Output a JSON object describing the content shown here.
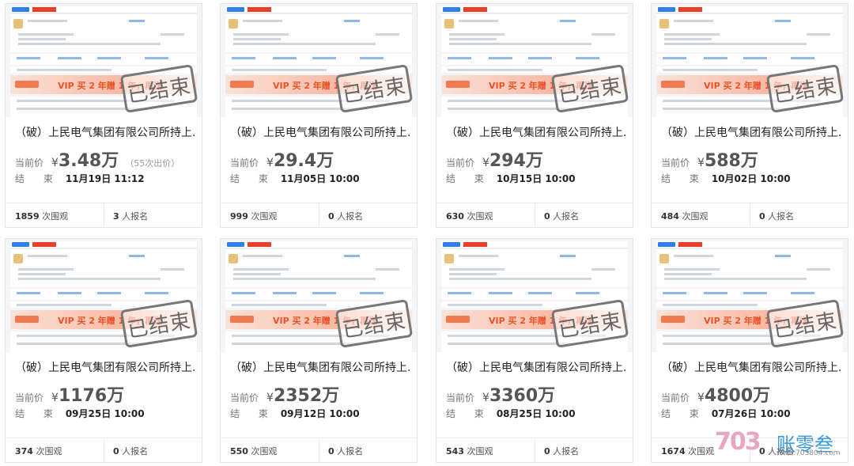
{
  "promo_text": "VIP 买 2 年赠 1 年，再送",
  "stamp_text": "已结束",
  "labels": {
    "current_price": "当前价",
    "end": "结  束",
    "currency": "¥"
  },
  "cards": [
    {
      "title": "（破）上民电气集团有限公司所持上...",
      "price": "3.48万",
      "bids": "（55次出价）",
      "end_time": "11月19日 11:12",
      "views": "1859",
      "views_unit": "次围观",
      "signups": "3",
      "signups_unit": "人报名"
    },
    {
      "title": "（破）上民电气集团有限公司所持上...",
      "price": "29.4万",
      "bids": "",
      "end_time": "11月05日 10:00",
      "views": "999",
      "views_unit": "次围观",
      "signups": "0",
      "signups_unit": "人报名"
    },
    {
      "title": "（破）上民电气集团有限公司所持上...",
      "price": "294万",
      "bids": "",
      "end_time": "10月15日 10:00",
      "views": "630",
      "views_unit": "次围观",
      "signups": "0",
      "signups_unit": "人报名"
    },
    {
      "title": "（破）上民电气集团有限公司所持上...",
      "price": "588万",
      "bids": "",
      "end_time": "10月02日 10:00",
      "views": "484",
      "views_unit": "次围观",
      "signups": "0",
      "signups_unit": "人报名"
    },
    {
      "title": "（破）上民电气集团有限公司所持上...",
      "price": "1176万",
      "bids": "",
      "end_time": "09月25日 10:00",
      "views": "374",
      "views_unit": "次围观",
      "signups": "0",
      "signups_unit": "人报名"
    },
    {
      "title": "（破）上民电气集团有限公司所持上...",
      "price": "2352万",
      "bids": "",
      "end_time": "09月12日 10:00",
      "views": "550",
      "views_unit": "次围观",
      "signups": "0",
      "signups_unit": "人报名"
    },
    {
      "title": "（破）上民电气集团有限公司所持上...",
      "price": "3360万",
      "bids": "",
      "end_time": "08月25日 10:00",
      "views": "543",
      "views_unit": "次围观",
      "signups": "0",
      "signups_unit": "人报名"
    },
    {
      "title": "（破）上民电气集团有限公司所持上...",
      "price": "4800万",
      "bids": "",
      "end_time": "07月26日 10:00",
      "views": "1674",
      "views_unit": "次围观",
      "signups": "0",
      "signups_unit": "人报名"
    }
  ],
  "watermark": {
    "logo": "703",
    "name": "账零叁",
    "url": "www.703804.com"
  }
}
